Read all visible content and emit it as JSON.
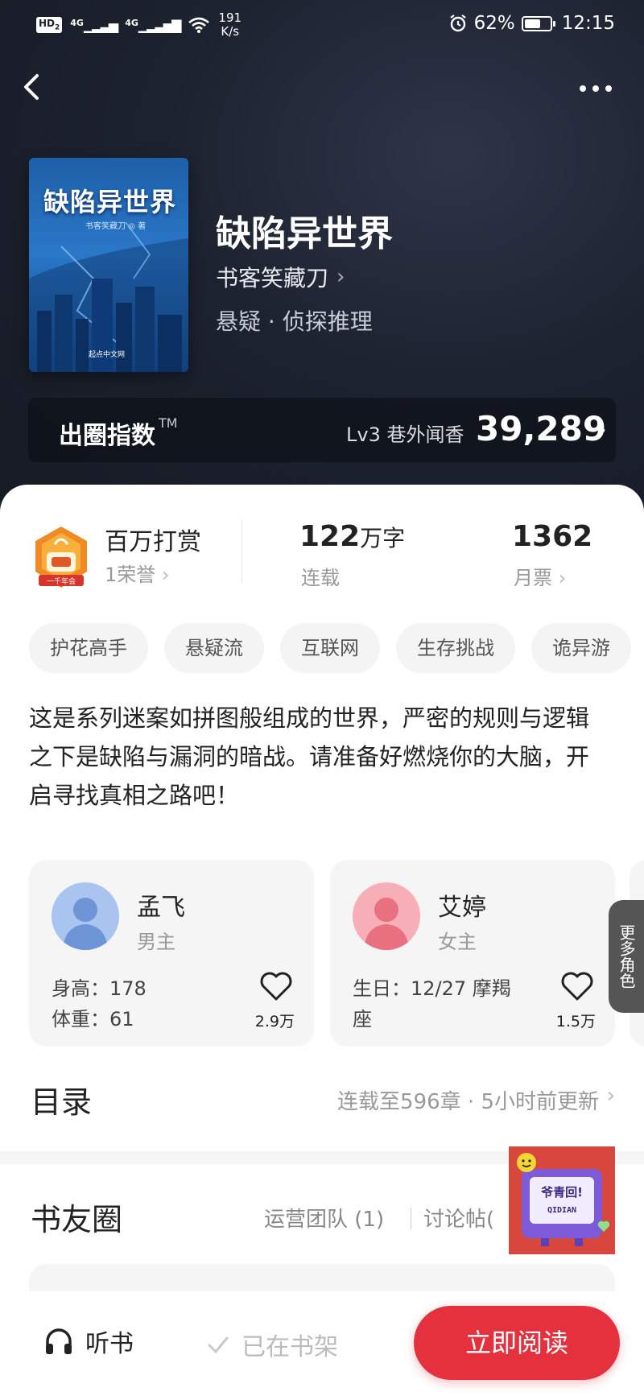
{
  "status_bar": {
    "hd": "HD",
    "hd_sub": "2",
    "net1": "4G",
    "net2": "4G",
    "speed_value": "191",
    "speed_unit": "K/s",
    "battery": "62%",
    "battery_level": 0.62,
    "time": "12:15"
  },
  "book": {
    "cover_title": "缺陷异世界",
    "cover_author": "书客笑藏刀 ◎ 著",
    "cover_publisher": "起点中文网",
    "title": "缺陷异世界",
    "author": "书客笑藏刀",
    "genre": "悬疑 · 侦探推理"
  },
  "index_bar": {
    "label": "出圈指数",
    "trademark": "TM",
    "level": "Lv3 巷外闻香",
    "score": "39,289"
  },
  "stats": {
    "reward_title": "百万打赏",
    "reward_sub": "1荣誉",
    "words_value": "122",
    "words_unit": "万字",
    "words_label": "连载",
    "tickets_value": "1362",
    "tickets_label": "月票",
    "badge_text": "一千年会"
  },
  "tags": [
    "护花高手",
    "悬疑流",
    "互联网",
    "生存挑战",
    "诡异游"
  ],
  "description": "这是系列迷案如拼图般组成的世界，严密的规则与逻辑之下是缺陷与漏洞的暗战。请准备好燃烧你的大脑，开启寻找真相之路吧！",
  "roles": [
    {
      "name": "孟飞",
      "role": "男主",
      "line1": "身高：178",
      "line2": "体重：61",
      "likes": "2.9万"
    },
    {
      "name": "艾婷",
      "role": "女主",
      "line1": "生日：12/27 摩羯",
      "line2": "座",
      "likes": "1.5万"
    }
  ],
  "more_roles": "更多角色",
  "toc": {
    "title": "目录",
    "info": "连载至596章 · 5小时前更新"
  },
  "club": {
    "title": "书友圈",
    "tab1": "运营团队 (1)",
    "tab2": "讨论帖(",
    "sticker_text": "爷青回!",
    "sticker_brand": "QIDIAN"
  },
  "bottom": {
    "listen": "听书",
    "shelf": "已在书架",
    "read": "立即阅读"
  },
  "colors": {
    "accent": "#e5303d",
    "hero_bg": "#1b2030"
  }
}
